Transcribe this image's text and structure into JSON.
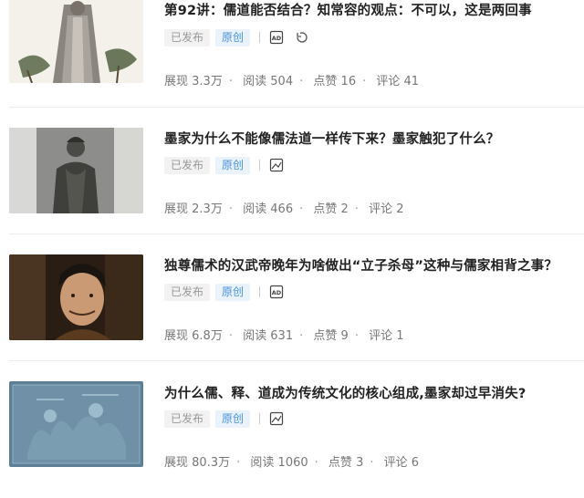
{
  "articles": [
    {
      "title": "第92讲：儒道能否结合？知常容的观点：不可以，这是两回事",
      "status": "已发布",
      "type": "原创",
      "icons": [
        "ad-icon",
        "refresh-icon"
      ],
      "stats": {
        "views_label": "展现",
        "views": "3.3万",
        "reads_label": "阅读",
        "reads": "504",
        "likes_label": "点赞",
        "likes": "16",
        "comments_label": "评论",
        "comments": "41"
      }
    },
    {
      "title": "墨家为什么不能像儒法道一样传下来？墨家触犯了什么？",
      "status": "已发布",
      "type": "原创",
      "icons": [
        "image-icon"
      ],
      "stats": {
        "views_label": "展现",
        "views": "2.3万",
        "reads_label": "阅读",
        "reads": "466",
        "likes_label": "点赞",
        "likes": "2",
        "comments_label": "评论",
        "comments": "2"
      }
    },
    {
      "title": "独尊儒术的汉武帝晚年为啥做出“立子杀母”这种与儒家相背之事？",
      "status": "已发布",
      "type": "原创",
      "icons": [
        "ad-icon"
      ],
      "stats": {
        "views_label": "展现",
        "views": "6.8万",
        "reads_label": "阅读",
        "reads": "631",
        "likes_label": "点赞",
        "likes": "9",
        "comments_label": "评论",
        "comments": "1"
      }
    },
    {
      "title": "为什么儒、释、道成为传统文化的核心组成,墨家却过早消失?",
      "status": "已发布",
      "type": "原创",
      "icons": [
        "image-icon"
      ],
      "stats": {
        "views_label": "展现",
        "views": "80.3万",
        "reads_label": "阅读",
        "reads": "1060",
        "likes_label": "点赞",
        "likes": "3",
        "comments_label": "评论",
        "comments": "6"
      }
    }
  ]
}
